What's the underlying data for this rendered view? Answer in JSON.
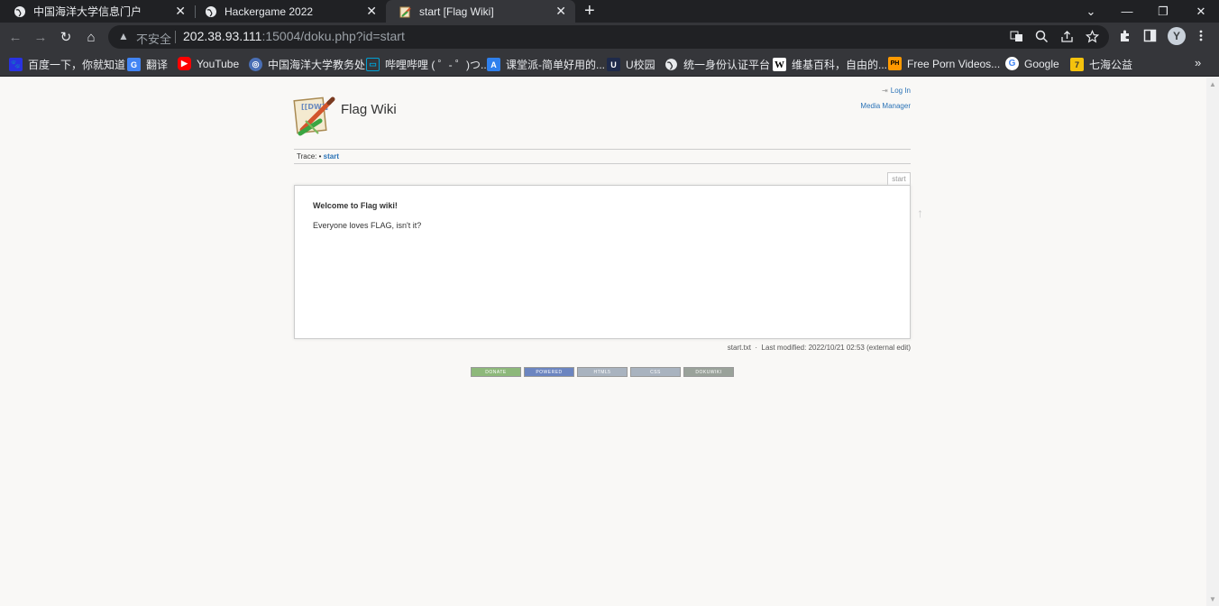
{
  "browser": {
    "tabs": [
      {
        "title": "中国海洋大学信息门户",
        "active": false,
        "icon": "globe-icon"
      },
      {
        "title": "Hackergame 2022",
        "active": false,
        "icon": "globe-icon"
      },
      {
        "title": "start [Flag Wiki]",
        "active": true,
        "icon": "dokuwiki-icon"
      }
    ],
    "tab_close": "✕",
    "new_tab": "+",
    "window_controls": {
      "dropdown": "⌄",
      "minimize": "—",
      "restore": "❐",
      "close": "✕"
    },
    "nav": {
      "back": "←",
      "forward": "→",
      "reload": "↻",
      "home": "⌂"
    },
    "omnibox": {
      "warning_icon": "▲",
      "security_label": "不安全",
      "url_host": "202.38.93.111",
      "url_rest": ":15004/doku.php?id=start"
    },
    "profile_initial": "Y",
    "bookmarks": [
      {
        "label": "百度一下，你就知道",
        "icon": "baidu-icon",
        "color": "#2932e1"
      },
      {
        "label": "翻译",
        "icon": "translate-icon",
        "color": "#4285f4"
      },
      {
        "label": "YouTube",
        "icon": "youtube-icon",
        "color": "#ff0000"
      },
      {
        "label": "中国海洋大学教务处",
        "icon": "ouc-icon",
        "color": "#4a6fb5"
      },
      {
        "label": "哔哩哔哩 ( ゜- ゜)つ...",
        "icon": "bilibili-icon",
        "color": "#00a1d6"
      },
      {
        "label": "课堂派-简单好用的...",
        "icon": "ketangpai-icon",
        "color": "#2f80ed"
      },
      {
        "label": "U校园",
        "icon": "uxiaoyuan-icon",
        "color": "#1e2a4a"
      },
      {
        "label": "统一身份认证平台",
        "icon": "globe-icon",
        "color": "#5f6368"
      },
      {
        "label": "维基百科，自由的...",
        "icon": "wikipedia-icon",
        "color": "#ffffff"
      },
      {
        "label": "Free Porn Videos...",
        "icon": "ph-icon",
        "color": "#ff9900"
      },
      {
        "label": "Google",
        "icon": "google-icon",
        "color": "#ffffff"
      },
      {
        "label": "七海公益",
        "icon": "qihai-icon",
        "color": "#f4c20d"
      }
    ],
    "bookmarks_more": "»"
  },
  "wiki": {
    "title": "Flag Wiki",
    "login_label": "Log In",
    "media_manager_label": "Media Manager",
    "trace_label": "Trace:",
    "trace_separator": "•",
    "trace_link": "start",
    "page_id": "start",
    "heading": "Welcome to Flag wiki!",
    "body": "Everyone loves FLAG, isn't it?",
    "back_to_top": "↑",
    "doc_file": "start.txt",
    "doc_modified": "Last modified: 2022/10/21 02:53 (external edit)",
    "badges": [
      {
        "label": "DONATE",
        "color": "#8db87a"
      },
      {
        "label": "POWERED",
        "color": "#6c85c0"
      },
      {
        "label": "HTML5",
        "color": "#a9b3bf"
      },
      {
        "label": "CSS",
        "color": "#a9b3bf"
      },
      {
        "label": "DOKUWIKI",
        "color": "#9aa29a"
      }
    ]
  }
}
